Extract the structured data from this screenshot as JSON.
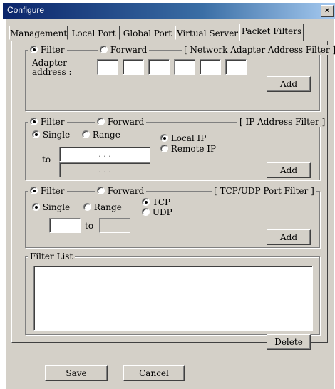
{
  "window": {
    "title": "Configure",
    "close_glyph": "×"
  },
  "tabs": [
    {
      "label": "Management",
      "active": false
    },
    {
      "label": "Local Port",
      "active": false
    },
    {
      "label": "Global Port",
      "active": false
    },
    {
      "label": "Virtual Server",
      "active": false
    },
    {
      "label": "Packet Filters",
      "active": true
    }
  ],
  "adapter_filter": {
    "filter_label": "Filter",
    "forward_label": "Forward",
    "selected": "Filter",
    "group_title": "[ Network Adapter Address Filter ]",
    "address_label_line1": "Adapter",
    "address_label_line2": "address :",
    "address_octets": [
      "",
      "",
      "",
      "",
      "",
      ""
    ],
    "add_label": "Add"
  },
  "ip_filter": {
    "filter_label": "Filter",
    "forward_label": "Forward",
    "selected": "Filter",
    "group_title": "[ IP Address Filter ]",
    "single_label": "Single",
    "range_label": "Range",
    "mode_selected": "Single",
    "local_ip_label": "Local IP",
    "remote_ip_label": "Remote IP",
    "scope_selected": "Local IP",
    "to_label": "to",
    "ip_from": ". . .",
    "ip_to": ". . .",
    "add_label": "Add"
  },
  "port_filter": {
    "filter_label": "Filter",
    "forward_label": "Forward",
    "selected": "Filter",
    "group_title": "[ TCP/UDP Port Filter ]",
    "single_label": "Single",
    "range_label": "Range",
    "mode_selected": "Single",
    "tcp_label": "TCP",
    "udp_label": "UDP",
    "protocol_selected": "TCP",
    "to_label": "to",
    "port_from": "",
    "port_to": "",
    "add_label": "Add"
  },
  "filter_list": {
    "title": "Filter List",
    "items": [],
    "delete_label": "Delete"
  },
  "footer": {
    "save_label": "Save",
    "cancel_label": "Cancel"
  }
}
